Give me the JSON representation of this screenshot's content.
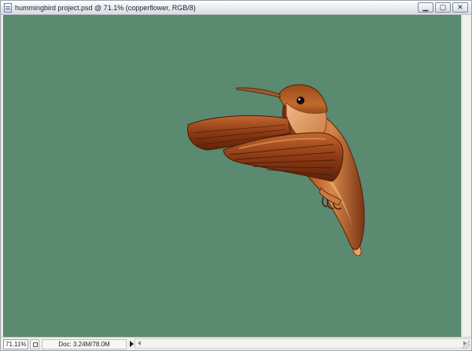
{
  "window": {
    "title": "hummingbird project.psd @ 71.1% (copperflower, RGB/8)",
    "controls": {
      "minimize": "▁",
      "maximize": "▢",
      "close": "✕"
    }
  },
  "canvas": {
    "background_color": "#5a8a6f",
    "content": "hummingbird-illustration"
  },
  "statusbar": {
    "zoom": "71.11%",
    "doc_info": "Doc: 3.24M/78.0M"
  },
  "icons": {
    "document": "document-icon",
    "status_nav": "navigator-icon",
    "status_menu": "status-menu-arrow-icon"
  }
}
